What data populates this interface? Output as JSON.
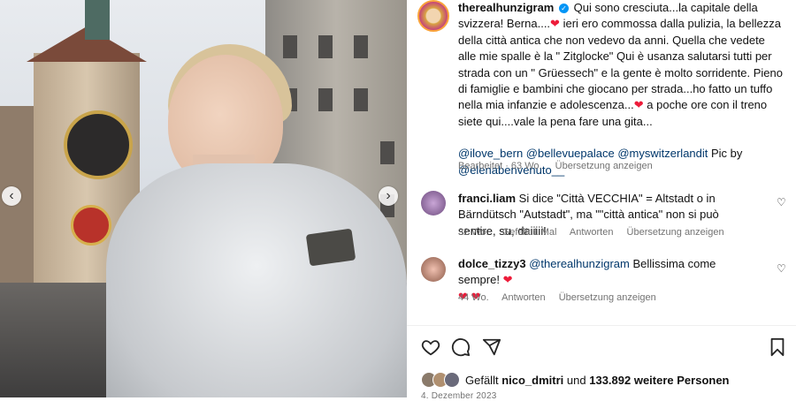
{
  "post": {
    "username": "therealhunzigram",
    "caption_parts": [
      "Qui sono cresciuta...la capitale della svizzera! Berna....",
      "ieri ero commossa dalla pulizia, la bellezza della città antica che non vedevo da anni. Quella che vedete alle mie spalle è la \" Zitglocke\" Qui è usanza salutarsi tutti per strada con un \" Grüessech\" e la gente è molto sorridente. Pieno di famiglie e bambini che giocano per strada...ho fatto un tuffo nella mia infanzie e adolescenza...",
      "a poche ore con il treno siete qui....vale la pena fare una gita..."
    ],
    "mentions": "@ilove_bern @bellevuepalace @myswitzerlandit",
    "credit_suffix": " Pic by",
    "credit_mention": "@elenabenvenuto__",
    "edited": "Bearbeitet · 63 Wo.",
    "translate": "Übersetzung anzeigen"
  },
  "comments": [
    {
      "username": "franci.liam",
      "text": "Si dice \"Città VECCHIA\" = Altstadt o in Bärndütsch \"Autstadt\", ma \"\"città antica\" non si può sentire, su, daiiiii!",
      "age": "32 Wo.",
      "likes": "Gefällt 1 Mal",
      "reply": "Antworten",
      "translate": "Übersetzung anzeigen"
    },
    {
      "username": "dolce_tizzy3",
      "mention": "@therealhunzigram",
      "text": "Bellissima come sempre!",
      "age": "44 Wo.",
      "reply": "Antworten",
      "translate": "Übersetzung anzeigen"
    }
  ],
  "actions": {
    "like_icon": "heart-outline-icon",
    "comment_icon": "comment-icon",
    "share_icon": "share-icon",
    "save_icon": "bookmark-icon"
  },
  "likes": {
    "prefix": "Gefällt",
    "user": "nico_dmitri",
    "middle": "und",
    "count": "133.892 weitere Personen"
  },
  "date": "4. Dezember 2023",
  "colors": {
    "heart": "#ed1c3a",
    "link": "#00376b",
    "meta": "#737373",
    "verified": "#0095f6"
  }
}
